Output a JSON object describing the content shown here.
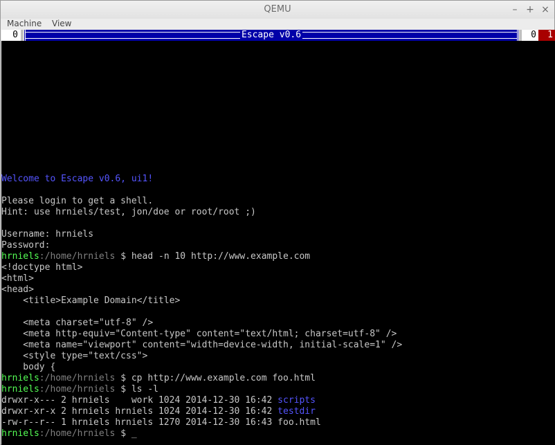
{
  "window": {
    "title": "QEMU",
    "minimize_glyph": "–",
    "maximize_glyph": "+",
    "close_glyph": "×"
  },
  "menu": {
    "machine": "Machine",
    "view": "View"
  },
  "vm_topbar": {
    "left_vt": "0",
    "title": "Escape v0.6",
    "right_vt_0": "0",
    "right_vt_1": "1"
  },
  "terminal": {
    "welcome": "Welcome to Escape v0.6, ui1!",
    "blank1": "",
    "login_msg": "Please login to get a shell.",
    "hint": "Hint: use hrniels/test, jon/doe or root/root ;)",
    "blank2": "",
    "username": "Username: hrniels",
    "password": "Password:",
    "prompt1": {
      "user": "hrniels",
      "path": ":/home/hrniels",
      "cmd": " $ head -n 10 http://www.example.com"
    },
    "out1": "<!doctype html>",
    "out2": "<html>",
    "out3": "<head>",
    "out4": "    <title>Example Domain</title>",
    "out5": "",
    "out6": "    <meta charset=\"utf-8\" />",
    "out7": "    <meta http-equiv=\"Content-type\" content=\"text/html; charset=utf-8\" />",
    "out8": "    <meta name=\"viewport\" content=\"width=device-width, initial-scale=1\" />",
    "out9": "    <style type=\"text/css\">",
    "out10": "    body {",
    "prompt2": {
      "user": "hrniels",
      "path": ":/home/hrniels",
      "cmd": " $ cp http://www.example.com foo.html"
    },
    "prompt3": {
      "user": "hrniels",
      "path": ":/home/hrniels",
      "cmd": " $ ls -l"
    },
    "ls_rows": [
      {
        "meta": "drwxr-x--- 2 hrniels    work 1024 2014-12-30 16:42 ",
        "name": "scripts",
        "dir": true
      },
      {
        "meta": "drwxr-xr-x 2 hrniels hrniels 1024 2014-12-30 16:42 ",
        "name": "testdir",
        "dir": true
      },
      {
        "meta": "-rw-r--r-- 1 hrniels hrniels 1270 2014-12-30 16:43 ",
        "name": "foo.html",
        "dir": false
      }
    ],
    "prompt4": {
      "user": "hrniels",
      "path": ":/home/hrniels",
      "cmd": " $ "
    },
    "cursor": "_"
  }
}
